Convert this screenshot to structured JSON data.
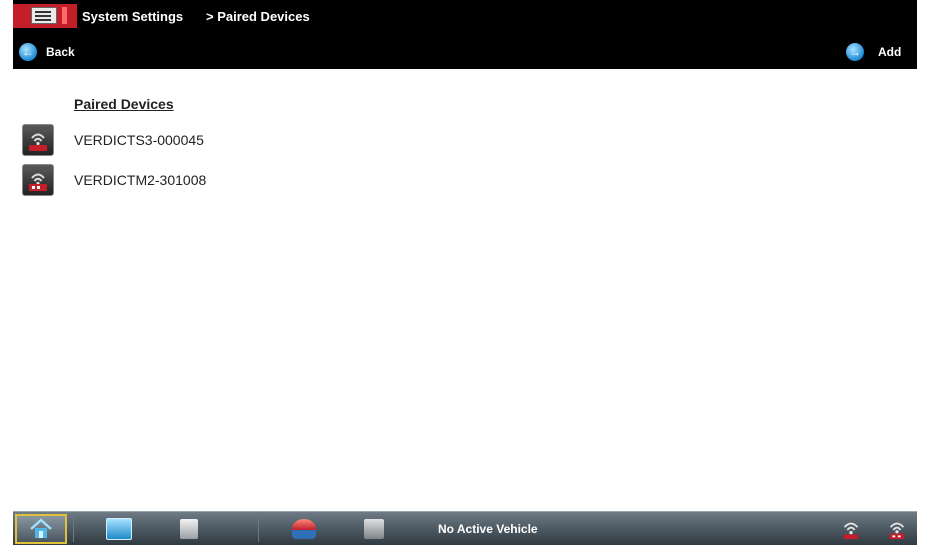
{
  "header": {
    "breadcrumb_root": "System Settings",
    "breadcrumb_current": "> Paired Devices"
  },
  "nav": {
    "back_label": "Back",
    "add_label": "Add"
  },
  "main": {
    "section_title": "Paired Devices",
    "devices": [
      {
        "name": "VERDICTS3-000045",
        "icon": "wireless-device-icon"
      },
      {
        "name": "VERDICTM2-301008",
        "icon": "wireless-device-icon"
      }
    ]
  },
  "taskbar": {
    "vehicle_status": "No Active Vehicle",
    "buttons": [
      "home-icon",
      "vehicle-data-icon",
      "notes-icon",
      "shop-stream-icon",
      "scanner-icon",
      "wireless-status-icon",
      "device-status-icon"
    ]
  },
  "colors": {
    "bar_background": "#000000",
    "brand_red": "#c41e2a",
    "accent_blue": "#1d8ad6",
    "home_highlight": "#e0c23a"
  }
}
